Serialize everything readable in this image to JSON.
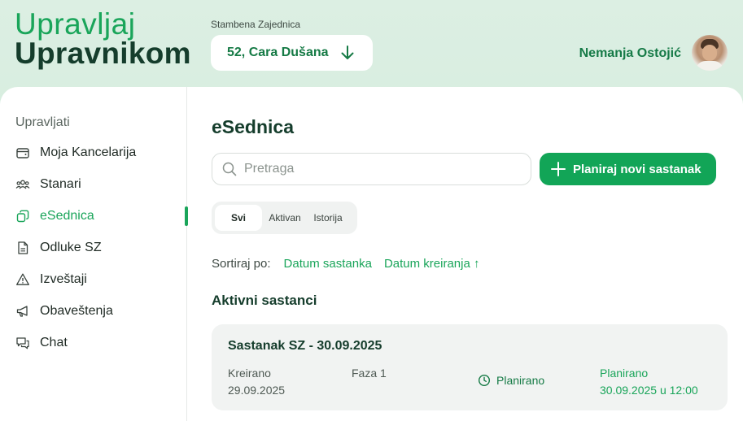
{
  "brand": {
    "line1": "Upravljaj",
    "line2": "Upravnikom"
  },
  "community": {
    "label": "Stambena Zajednica",
    "address": "52, Cara Dušana"
  },
  "user": {
    "name": "Nemanja Ostojić"
  },
  "sidebar": {
    "heading": "Upravljati",
    "items": [
      {
        "label": "Moja Kancelarija",
        "icon": "wallet-icon"
      },
      {
        "label": "Stanari",
        "icon": "users-icon"
      },
      {
        "label": "eSednica",
        "icon": "copy-icon",
        "active": true
      },
      {
        "label": "Odluke SZ",
        "icon": "document-icon"
      },
      {
        "label": "Izveštaji",
        "icon": "warning-icon"
      },
      {
        "label": "Obaveštenja",
        "icon": "megaphone-icon"
      },
      {
        "label": "Chat",
        "icon": "chat-icon"
      }
    ]
  },
  "main": {
    "title": "eSednica",
    "search": {
      "placeholder": "Pretraga",
      "value": ""
    },
    "new_button": "Planiraj novi sastanak",
    "tabs": [
      {
        "label": "Svi",
        "active": true
      },
      {
        "label": "Aktivan"
      },
      {
        "label": "Istorija"
      }
    ],
    "sort": {
      "label": "Sortiraj po:",
      "options": [
        "Datum sastanka",
        "Datum kreiranja ↑"
      ]
    },
    "section_title": "Aktivni sastanci",
    "meetings": [
      {
        "title": "Sastanak SZ - 30.09.2025",
        "created_label": "Kreirano",
        "created_date": "29.09.2025",
        "phase": "Faza 1",
        "status": "Planirano",
        "planned_label": "Planirano",
        "planned_date": "30.09.2025 u 12:00"
      }
    ]
  },
  "colors": {
    "accent": "#1aa55a",
    "dark_green": "#153d2c",
    "header_bg": "#d6ecdf"
  }
}
